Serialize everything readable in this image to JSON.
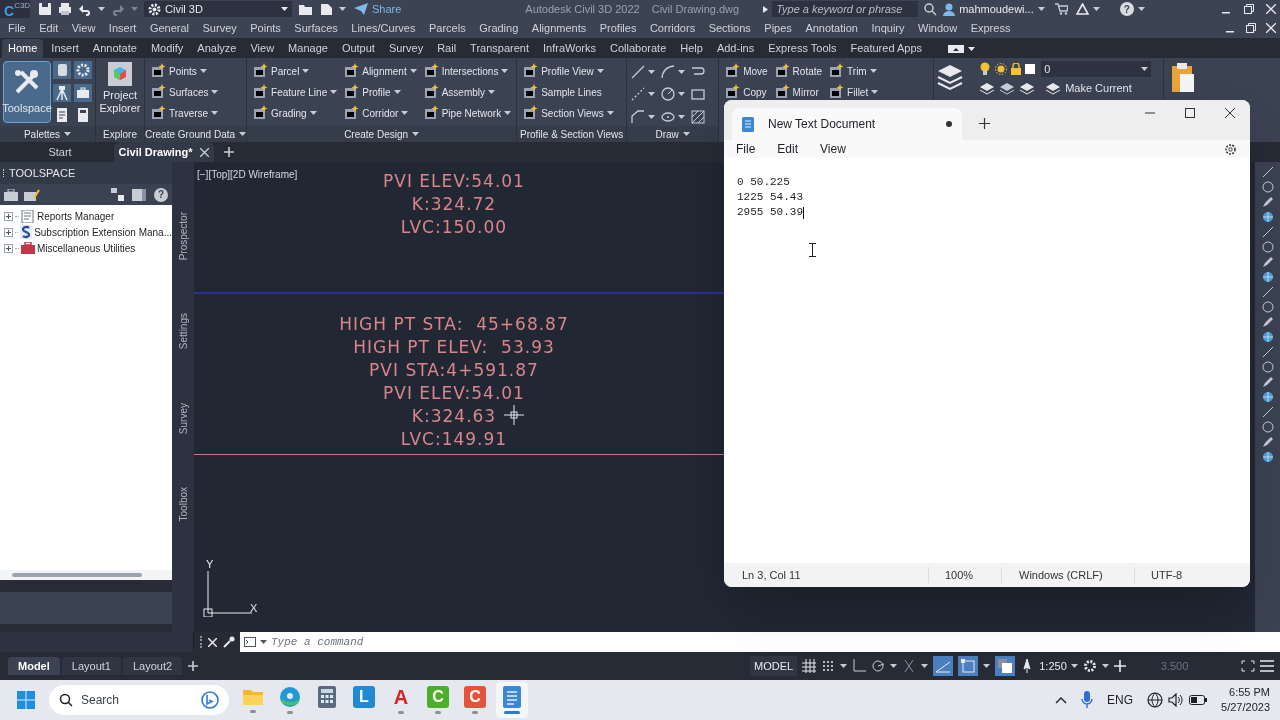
{
  "title_bar": {
    "logo_letter": "C",
    "logo_badge": "C3D",
    "workspace": "Civil 3D",
    "share": "Share",
    "app_title": "Autodesk Civil 3D 2022",
    "file_name": "Civil Drawing.dwg",
    "search_placeholder": "Type a keyword or phrase",
    "user": "mahmoudewi...",
    "help": "?"
  },
  "menu_bar": [
    "File",
    "Edit",
    "View",
    "Insert",
    "General",
    "Survey",
    "Points",
    "Surfaces",
    "Lines/Curves",
    "Parcels",
    "Grading",
    "Alignments",
    "Profiles",
    "Corridors",
    "Sections",
    "Pipes",
    "Annotation",
    "Inquiry",
    "Window",
    "Express"
  ],
  "ribbon_tabs": [
    {
      "label": "Home",
      "selected": true
    },
    {
      "label": "Insert",
      "selected": false
    },
    {
      "label": "Annotate",
      "selected": false
    },
    {
      "label": "Modify",
      "selected": false
    },
    {
      "label": "Analyze",
      "selected": false
    },
    {
      "label": "View",
      "selected": false
    },
    {
      "label": "Manage",
      "selected": false
    },
    {
      "label": "Output",
      "selected": false
    },
    {
      "label": "Survey",
      "selected": false
    },
    {
      "label": "Rail",
      "selected": false
    },
    {
      "label": "Transparent",
      "selected": false
    },
    {
      "label": "InfraWorks",
      "selected": false
    },
    {
      "label": "Collaborate",
      "selected": false
    },
    {
      "label": "Help",
      "selected": false
    },
    {
      "label": "Add-ins",
      "selected": false
    },
    {
      "label": "Express Tools",
      "selected": false
    },
    {
      "label": "Featured Apps",
      "selected": false
    }
  ],
  "ribbon_panels": [
    {
      "kind": "palettes",
      "title": "Palettes",
      "title_dropdown": true,
      "big_label": "Toolspace",
      "selected": true
    },
    {
      "kind": "big",
      "title": "Explore",
      "title_dropdown": false,
      "big_label": "Project Explorer"
    },
    {
      "kind": "list",
      "title": "Create Ground Data",
      "title_dropdown": true,
      "columns": [
        [
          {
            "label": "Points",
            "dropdown": true
          },
          {
            "label": "Surfaces",
            "dropdown": true
          },
          {
            "label": "Traverse",
            "dropdown": true
          }
        ]
      ]
    },
    {
      "kind": "list",
      "title": "Create Design",
      "title_dropdown": true,
      "columns": [
        [
          {
            "label": "Parcel",
            "dropdown": true
          },
          {
            "label": "Feature Line",
            "dropdown": true
          },
          {
            "label": "Grading",
            "dropdown": true
          }
        ],
        [
          {
            "label": "Alignment",
            "dropdown": true
          },
          {
            "label": "Profile",
            "dropdown": true
          },
          {
            "label": "Corridor",
            "dropdown": true
          }
        ],
        [
          {
            "label": "Intersections",
            "dropdown": true
          },
          {
            "label": "Assembly",
            "dropdown": true
          },
          {
            "label": "Pipe Network",
            "dropdown": true
          }
        ]
      ]
    },
    {
      "kind": "list",
      "title": "Profile & Section Views",
      "title_dropdown": false,
      "columns": [
        [
          {
            "label": "Profile View",
            "dropdown": true
          },
          {
            "label": "Sample Lines",
            "dropdown": false
          },
          {
            "label": "Section Views",
            "dropdown": true
          }
        ]
      ]
    },
    {
      "kind": "draw",
      "title": "Draw",
      "title_dropdown": true
    },
    {
      "kind": "list",
      "columns": [
        [
          {
            "label": "Move",
            "dropdown": false
          },
          {
            "label": "Copy",
            "dropdown": false
          }
        ],
        [
          {
            "label": "Rotate",
            "dropdown": false
          },
          {
            "label": "Mirror",
            "dropdown": false
          }
        ],
        [
          {
            "label": "Trim",
            "dropdown": true
          },
          {
            "label": "Fillet",
            "dropdown": true
          }
        ]
      ]
    },
    {
      "kind": "layers",
      "layer_name": "0",
      "action": "Make Current"
    }
  ],
  "doc_tabs": [
    {
      "label": "Start",
      "selected": false
    },
    {
      "label": "Civil Drawing*",
      "selected": true
    }
  ],
  "toolspace": {
    "title": "TOOLSPACE",
    "items": [
      {
        "label": "Reports Manager",
        "expanded": false
      },
      {
        "label": "Subscription Extension Mana...",
        "expanded": false
      },
      {
        "label": "Miscellaneous Utilities",
        "expanded": false
      }
    ]
  },
  "side_tabs": [
    "Prospector",
    "Settings",
    "Survey",
    "Toolbox"
  ],
  "canvas": {
    "viewport_label": "[−][Top][2D Wireframe]",
    "upper_labels": [
      "PVI ELEV:54.01",
      "K:324.72",
      "LVC:150.00"
    ],
    "lower_labels": [
      "HIGH PT STA:  45+68.87",
      "HIGH PT ELEV:  53.93",
      "PVI STA:4+591.87",
      "PVI ELEV:54.01",
      "K:324.63",
      "LVC:149.91"
    ],
    "ucs": {
      "x": "X",
      "y": "Y"
    }
  },
  "notepad": {
    "tab_title": "New Text Document",
    "unsaved": true,
    "menu": [
      "File",
      "Edit",
      "View"
    ],
    "lines": [
      "0 50.225",
      "1225 54.43",
      "2955 50.39"
    ],
    "status": [
      "Ln 3, Col 11",
      "100%",
      "Windows (CRLF)",
      "UTF-8"
    ]
  },
  "command_line": {
    "placeholder": "Type a command"
  },
  "layout_tabs": [
    {
      "label": "Model",
      "selected": true
    },
    {
      "label": "Layout1",
      "selected": false
    },
    {
      "label": "Layout2",
      "selected": false
    }
  ],
  "status_bar": {
    "space": "MODEL",
    "scale": "1:250",
    "value": "3.500"
  },
  "taskbar": {
    "search_placeholder": "Search",
    "apps": [
      {
        "kind": "folder",
        "running": true,
        "selected": false
      },
      {
        "kind": "browser",
        "running": true,
        "selected": false
      },
      {
        "kind": "calculator",
        "running": false,
        "selected": false
      },
      {
        "kind": "tile",
        "letter": "L",
        "color": "#1f8ad2",
        "running": false,
        "selected": false
      },
      {
        "kind": "tile_outline",
        "letter": "A",
        "color": "#d8232a",
        "running": true,
        "selected": false
      },
      {
        "kind": "tile",
        "letter": "C",
        "color": "#4caf2a",
        "running": true,
        "selected": false
      },
      {
        "kind": "tile",
        "letter": "C",
        "color": "#e5533a",
        "running": true,
        "selected": false
      },
      {
        "kind": "notepad",
        "running": true,
        "selected": true
      }
    ],
    "language": "ENG",
    "time": "6:55 PM",
    "date": "5/27/2023"
  }
}
